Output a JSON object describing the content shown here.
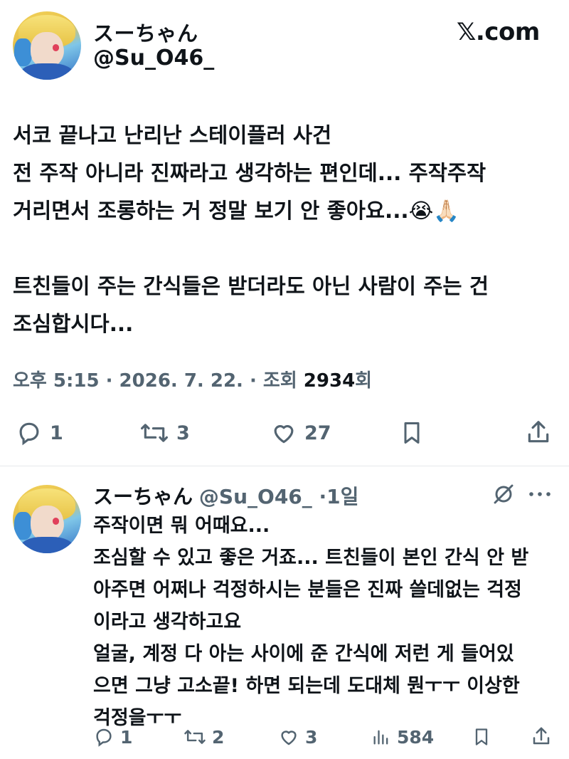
{
  "tweet": {
    "display_name": "スーちゃん",
    "handle": "@Su_O46_",
    "brand": "𝕏.com",
    "lines": [
      "서코 끝나고 난리난 스테이플러 사건",
      "전 주작 아니라 진짜라고 생각하는 편인데... 주작주작",
      "거리면서 조롱하는 거 정말 보기 안 좋아요...😭🙏🏻",
      "",
      "트친들이 주는 간식들은 받더라도 아닌 사람이 주는 건",
      "조심합시다..."
    ],
    "meta_time": "오후 5:15 · 2026. 7. 22. · 조회 ",
    "views": "2934",
    "views_suffix": "회",
    "reply_count": "1",
    "retweet_count": "3",
    "like_count": "27"
  },
  "reply": {
    "display_name": "スーちゃん",
    "handle_time": "@Su_O46_ ·1일",
    "lines": [
      "주작이면 뭐 어때요...",
      "조심할 수 있고 좋은 거죠...  트친들이 본인 간식 안 받",
      "아주면 어쩌나 걱정하시는 분들은 진짜 쓸데없는 걱정",
      "이라고 생각하고요",
      "얼굴, 계정 다 아는 사이에 준 간식에 저런 게 들어있",
      "으면 그냥 고소끝! 하면 되는데 도대체 뭔ㅜㅜ 이상한",
      "걱정을ㅜㅜ"
    ],
    "reply_count": "1",
    "retweet_count": "2",
    "like_count": "3",
    "view_count": "584"
  },
  "icons": {
    "reply": "reply-icon",
    "retweet": "retweet-icon",
    "like": "heart-icon",
    "bookmark": "bookmark-icon",
    "share": "share-icon",
    "views": "views-icon",
    "grok": "grok-icon",
    "more": "more-icon"
  },
  "colors": {
    "text": "#0f1419",
    "muted": "#536471",
    "divider": "#e6e9eb"
  }
}
